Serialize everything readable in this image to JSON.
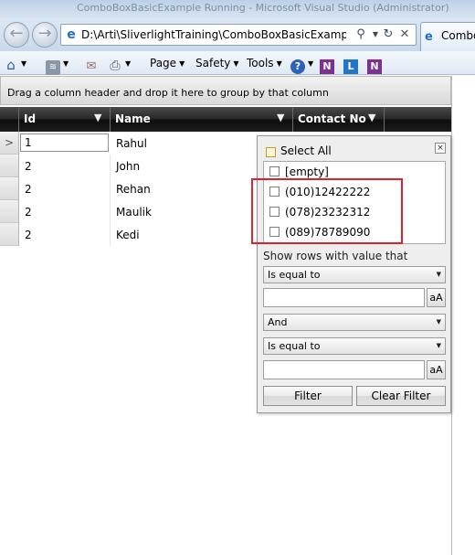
{
  "browser": {
    "title_bar_text": "ComboBoxBasicExample Running - Microsoft Visual Studio (Administrator)",
    "address": "D:\\Arti\\SliverlightTraining\\ComboBoxBasicExample\\Cor",
    "tab_label": "Combo",
    "back_glyph": "←",
    "forward_glyph": "→",
    "icons": {
      "favicon": "e",
      "search": "⚲",
      "dropdown": "▼",
      "refresh": "↻",
      "stop": "✕"
    },
    "command_bar": {
      "home_icon": "⌂",
      "feeds_icon": "≋",
      "mail_icon": "✉",
      "print_icon": "⎙",
      "page": "Page",
      "safety": "Safety",
      "tools": "Tools",
      "help_icon": "?",
      "onenote_icon": "N",
      "lync_icon": "L",
      "arrow": "▼"
    }
  },
  "grid": {
    "group_panel_text": "Drag a column header and drop it here to group by that column",
    "columns": [
      "Id",
      "Name",
      "Contact No"
    ],
    "filter_glyph": "▼",
    "row_indicator_current": ">",
    "rows": [
      {
        "id": "1",
        "name": "Rahul"
      },
      {
        "id": "2",
        "name": "John"
      },
      {
        "id": "2",
        "name": "Rehan"
      },
      {
        "id": "2",
        "name": "Maulik"
      },
      {
        "id": "2",
        "name": "Kedi"
      }
    ]
  },
  "filter_popup": {
    "select_all": "Select All",
    "close_glyph": "×",
    "values": [
      "[empty]",
      "(010)12422222",
      "(078)23232312",
      "(089)78789090"
    ],
    "show_rows_label": "Show rows with value that",
    "operator_1": "Is equal to",
    "logic": "And",
    "operator_2": "Is equal to",
    "value_1": "",
    "value_2": "",
    "case_button": "aA",
    "filter_button": "Filter",
    "clear_filter_button": "Clear Filter",
    "combo_arrow": "▼"
  },
  "colors": {
    "header_dark": "#1c1c1c",
    "highlight": "#e0202a",
    "popup_bg": "#eeeeee"
  }
}
